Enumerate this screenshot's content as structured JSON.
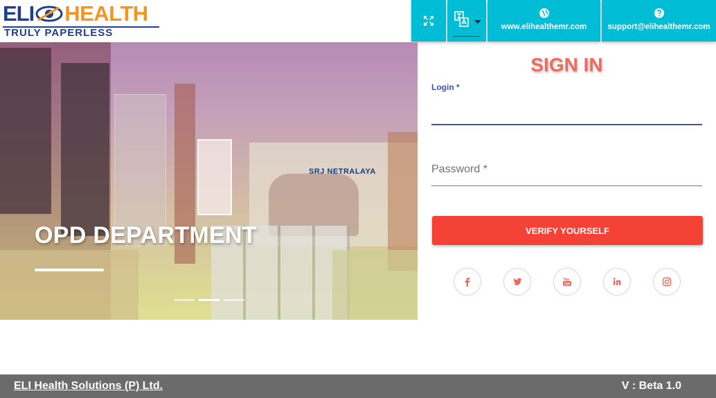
{
  "logo": {
    "brand_left": "ELI",
    "brand_right": "HEALTH",
    "tagline": "TRULY PAPERLESS",
    "colors": {
      "blue": "#1d3f8c",
      "orange": "#f7941d"
    }
  },
  "header": {
    "fullscreen_icon": "fullscreen-expand-icon",
    "language_icon": "translate-icon",
    "website": {
      "icon": "globe-icon",
      "label": "www.elihealthemr.com"
    },
    "support": {
      "icon": "help-circle-icon",
      "label": "support@elihealthemr.com"
    },
    "accent_color": "#00bcd4"
  },
  "hero": {
    "caption": "OPD DEPARTMENT",
    "sign_text": "SRJ NETRALAYA",
    "slides": 3,
    "active_slide": 2
  },
  "signin": {
    "title": "SIGN IN",
    "login_label": "Login *",
    "login_value": "",
    "password_placeholder": "Password *",
    "verify_button": "VERIFY YOURSELF",
    "button_color": "#f44336"
  },
  "social": [
    {
      "name": "facebook-icon",
      "glyph": "f"
    },
    {
      "name": "twitter-icon",
      "glyph": "t"
    },
    {
      "name": "youtube-icon",
      "glyph": "y"
    },
    {
      "name": "linkedin-icon",
      "glyph": "in"
    },
    {
      "name": "instagram-icon",
      "glyph": "ig"
    }
  ],
  "footer": {
    "company": "ELI Health Solutions (P) Ltd.",
    "version": "V : Beta 1.0"
  }
}
